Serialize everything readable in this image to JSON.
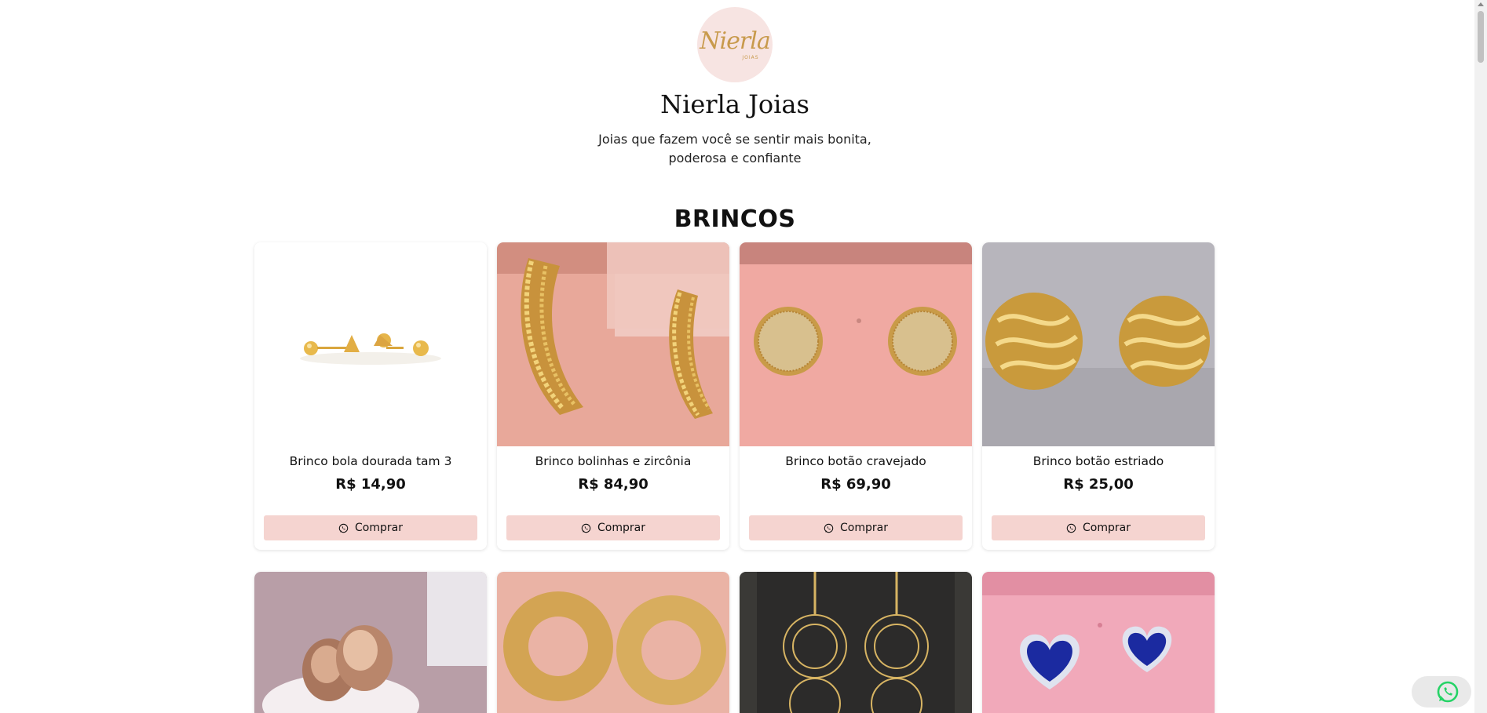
{
  "header": {
    "logo_text": "Nierla",
    "logo_sub": "JOIAS",
    "store_name": "Nierla Joias",
    "tagline": "Joias que fazem você se sentir mais bonita, poderosa e confiante"
  },
  "section": {
    "title": "BRINCOS"
  },
  "products": [
    {
      "name": "Brinco bola dourada tam 3",
      "price": "R$ 14,90",
      "button": "Comprar"
    },
    {
      "name": "Brinco bolinhas e zircônia",
      "price": "R$ 84,90",
      "button": "Comprar"
    },
    {
      "name": "Brinco botão cravejado",
      "price": "R$ 69,90",
      "button": "Comprar"
    },
    {
      "name": "Brinco botão estriado",
      "price": "R$ 25,00",
      "button": "Comprar"
    }
  ],
  "icons": {
    "buy": "whatsapp-icon",
    "floating": "whatsapp-icon"
  },
  "colors": {
    "button_bg": "#f5d4d0",
    "whatsapp_green": "#25d366",
    "logo_bg": "#f7e4e2",
    "gold": "#c89a4c"
  }
}
